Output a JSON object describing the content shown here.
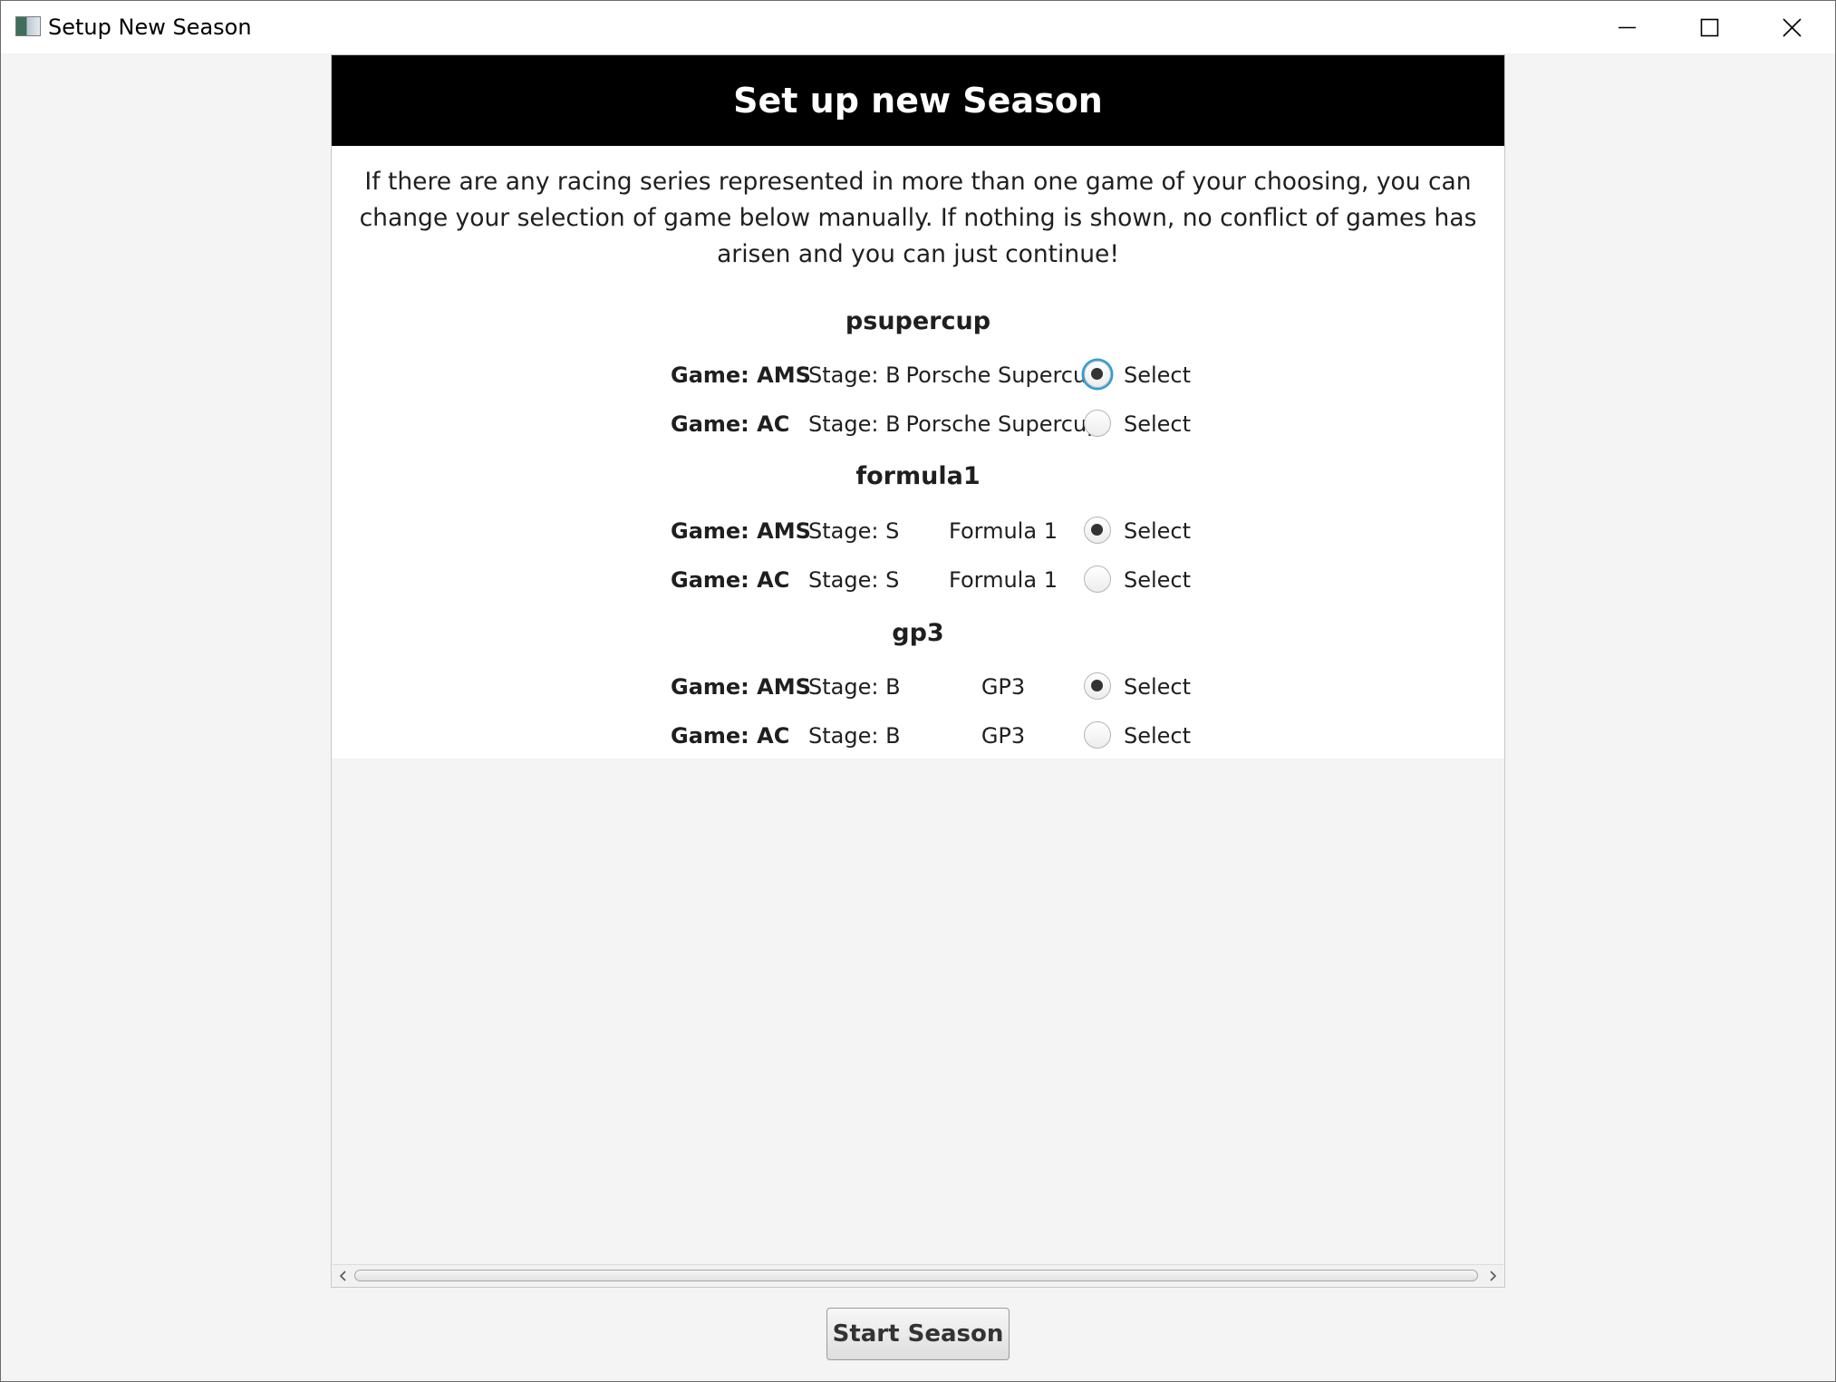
{
  "window": {
    "title": "Setup New Season",
    "icon": "app-icon",
    "controls": [
      "minimize-icon",
      "maximize-icon",
      "close-icon"
    ]
  },
  "header": {
    "title": "Set up new Season"
  },
  "intro": "If there are any racing series represented in more than one game of your choosing, you can change your selection of game below manually. If nothing is shown, no conflict of games has arisen and you can just continue!",
  "groups": [
    {
      "name": "psupercup",
      "rows": [
        {
          "game": "Game: AMS",
          "stage": "Stage: B",
          "series": "Porsche Supercup",
          "select_label": "Select",
          "selected": true,
          "focused": true
        },
        {
          "game": "Game: AC",
          "stage": "Stage: B",
          "series": "Porsche Supercup",
          "select_label": "Select",
          "selected": false
        }
      ]
    },
    {
      "name": "formula1",
      "rows": [
        {
          "game": "Game: AMS",
          "stage": "Stage: S",
          "series": "Formula 1",
          "select_label": "Select",
          "selected": true
        },
        {
          "game": "Game: AC",
          "stage": "Stage: S",
          "series": "Formula 1",
          "select_label": "Select",
          "selected": false
        }
      ]
    },
    {
      "name": "gp3",
      "rows": [
        {
          "game": "Game: AMS",
          "stage": "Stage: B",
          "series": "GP3",
          "select_label": "Select",
          "selected": true
        },
        {
          "game": "Game: AC",
          "stage": "Stage: B",
          "series": "GP3",
          "select_label": "Select",
          "selected": false
        }
      ]
    }
  ],
  "footer": {
    "start_button_label": "Start Season"
  },
  "colors": {
    "header_background": "#000000",
    "header_text": "#ffffff",
    "focus_ring": "#2b9fd9",
    "window_background": "#f4f4f4"
  }
}
